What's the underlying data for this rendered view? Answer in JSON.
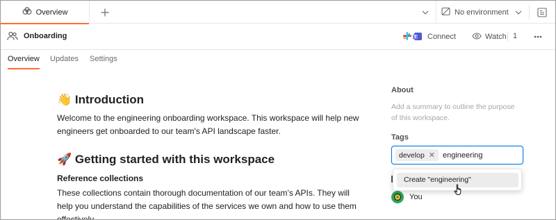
{
  "tabs": {
    "active_label": "Overview"
  },
  "environment": {
    "selected": "No environment"
  },
  "workspace": {
    "name": "Onboarding",
    "connect_label": "Connect",
    "watch_label": "Watch",
    "watch_count": "1"
  },
  "subtabs": [
    "Overview",
    "Updates",
    "Settings"
  ],
  "content": {
    "intro_emoji": "👋",
    "intro_heading": "Introduction",
    "intro_text": "Welcome to the engineering onboarding workspace. This workspace will help new engineers get onboarded to our team's API landscape faster.",
    "getting_started_emoji": "🚀",
    "getting_started_heading": "Getting started with this workspace",
    "ref_heading": "Reference collections",
    "ref_text": "These collections contain thorough documentation of our team's APIs. They will help you understand the capabilities of the services we own and how to use them effectively."
  },
  "about": {
    "title": "About",
    "placeholder": "Add a summary to outline the purpose of this workspace."
  },
  "tags": {
    "title": "Tags",
    "chips": [
      "develop"
    ],
    "input_value": "engineering",
    "suggestion": "Create \"engineering\""
  },
  "contributors": {
    "you_label": "You"
  },
  "colors": {
    "accent": "#ff6c37",
    "focus": "#097bed"
  }
}
